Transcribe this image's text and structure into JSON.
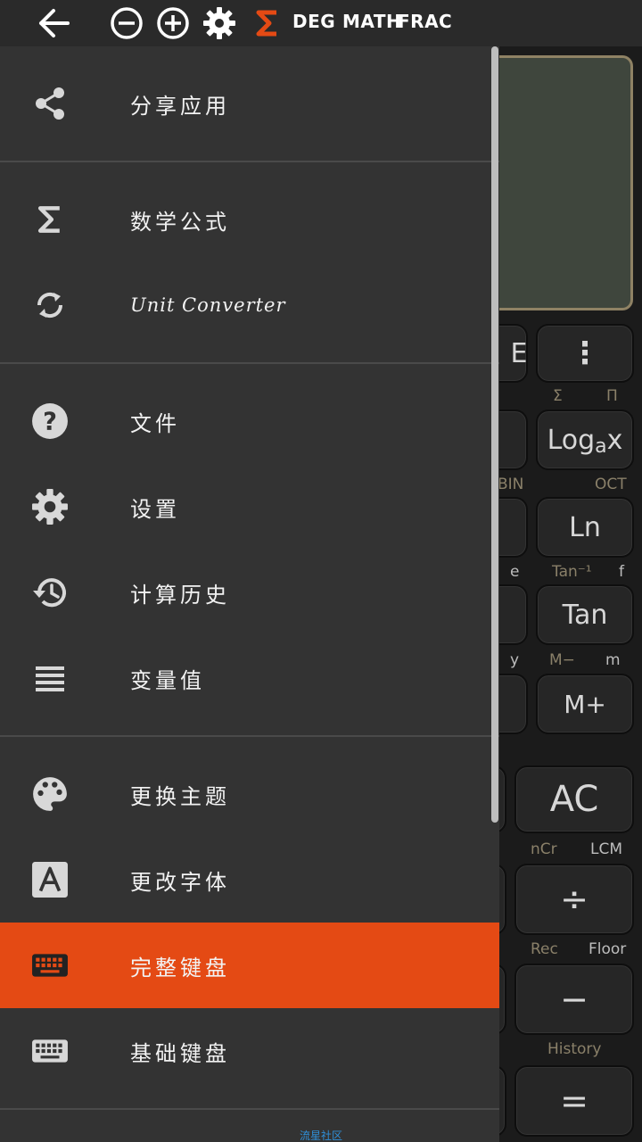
{
  "topbar": {
    "mode_deg": "DEG",
    "mode_math": "MATH",
    "mode_frac": "FRAC",
    "accent": "#e44a14"
  },
  "drawer": {
    "items": [
      {
        "label": "分享应用",
        "icon": "share-icon"
      },
      {
        "label": "数学公式",
        "icon": "sigma-icon"
      },
      {
        "label": "Unit Converter",
        "icon": "sync-icon"
      },
      {
        "label": "文件",
        "icon": "help-icon"
      },
      {
        "label": "设置",
        "icon": "gear-icon"
      },
      {
        "label": "计算历史",
        "icon": "history-icon"
      },
      {
        "label": "变量值",
        "icon": "list-icon"
      },
      {
        "label": "更换主题",
        "icon": "palette-icon"
      },
      {
        "label": "更改字体",
        "icon": "font-icon"
      },
      {
        "label": "完整键盘",
        "icon": "keyboard-icon",
        "active": true
      },
      {
        "label": "基础键盘",
        "icon": "keyboard-icon"
      }
    ]
  },
  "calculator": {
    "keys": {
      "e_key": "E",
      "more_key": "⋮",
      "log_key_main": "Log",
      "log_key_sub": "a",
      "log_key_x": "x",
      "ln_key": "Ln",
      "tan_key": "Tan",
      "mplus_key": "M+",
      "ac_key": "AC",
      "div_key": "÷",
      "minus_key": "−",
      "eq_key": "="
    },
    "labels": {
      "sigma": "Σ",
      "pi": "Π",
      "bin": "BIN",
      "oct": "OCT",
      "e": "e",
      "tan_inv": "Tan⁻¹",
      "f": "f",
      "y": "y",
      "m_minus": "M−",
      "m": "m",
      "ncr": "nCr",
      "lcm": "LCM",
      "rec": "Rec",
      "floor": "Floor",
      "history": "History"
    }
  },
  "footer": {
    "text": "流星社区"
  }
}
